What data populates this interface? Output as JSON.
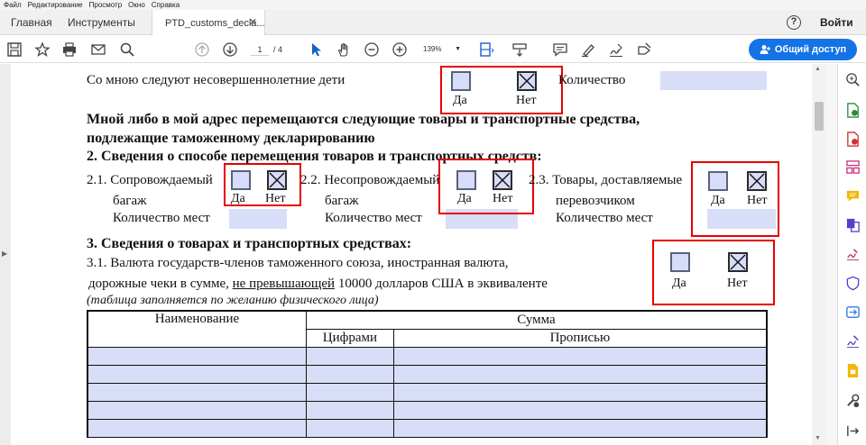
{
  "menu": [
    "Файл",
    "Редактирование",
    "Просмотр",
    "Окно",
    "Справка"
  ],
  "tabs": {
    "home": "Главная",
    "tools": "Инструменты",
    "document": "PTD_customs_decla...",
    "close": "✕"
  },
  "header": {
    "help": "?",
    "signin": "Войти"
  },
  "toolbar": {
    "page_current": "1",
    "page_total": "/ 4",
    "zoom": "139%",
    "share_label": "Общий доступ"
  },
  "form": {
    "children_label": "Со мною следуют несовершеннолетние дети",
    "quantity_label": "Количество",
    "yes": "Да",
    "no": "Нет",
    "goods_heading_line1": "Мной либо в мой адрес перемещаются следующие товары и транспортные средства,",
    "goods_heading_line2": "подлежащие таможенному декларированию",
    "section2_title": "2. Сведения о способе перемещения товаров и транспортных средств:",
    "s21_label": "2.1. Сопровождаемый",
    "s21_sub": "багаж",
    "s22_label": "2.2. Несопровождаемый",
    "s22_sub": "багаж",
    "s23_label": "2.3. Товары, доставляемые",
    "s23_sub": "перевозчиком",
    "places_label": "Количество мест",
    "section3_title": "3. Сведения о товарах и транспортных средствах:",
    "s31_line1": "3.1. Валюта государств-членов таможенного союза, иностранная валюта,",
    "s31_line2a": "дорожные чеки в сумме, ",
    "s31_line2b": "не превышающей",
    "s31_line2c": " 10000 долларов США в эквиваленте",
    "s31_note": "(таблица заполняется по желанию физического лица)",
    "table": {
      "col_name": "Наименование",
      "col_sum": "Сумма",
      "col_digits": "Цифрами",
      "col_words": "Прописью",
      "rows": 5
    }
  },
  "colors": {
    "field_fill": "#d9def8",
    "highlight_border": "#e60000",
    "share_button": "#1473e6"
  }
}
